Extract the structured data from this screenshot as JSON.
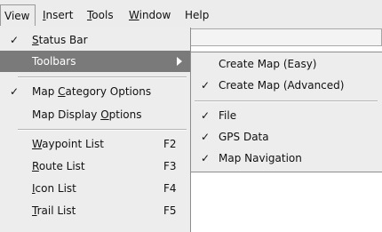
{
  "menubar": {
    "items": [
      {
        "prefix": "",
        "u": "",
        "rest": "View"
      },
      {
        "prefix": "",
        "u": "I",
        "rest": "nsert"
      },
      {
        "prefix": "",
        "u": "T",
        "rest": "ools"
      },
      {
        "prefix": "",
        "u": "W",
        "rest": "indow"
      },
      {
        "prefix": "",
        "u": "",
        "rest": "Help"
      }
    ]
  },
  "view_menu": {
    "items": [
      {
        "check": "✓",
        "prefix": "",
        "u": "S",
        "rest": "tatus Bar",
        "shortcut": ""
      },
      {
        "check": "",
        "prefix": "",
        "u": "",
        "rest": "Toolbars",
        "shortcut": ""
      },
      {
        "check": "✓",
        "prefix": "Map ",
        "u": "C",
        "rest": "ategory Options",
        "shortcut": ""
      },
      {
        "check": "",
        "prefix": "Map Display ",
        "u": "O",
        "rest": "ptions",
        "shortcut": ""
      },
      {
        "check": "",
        "prefix": "",
        "u": "W",
        "rest": "aypoint List",
        "shortcut": "F2"
      },
      {
        "check": "",
        "prefix": "",
        "u": "R",
        "rest": "oute List",
        "shortcut": "F3"
      },
      {
        "check": "",
        "prefix": "",
        "u": "I",
        "rest": "con List",
        "shortcut": "F4"
      },
      {
        "check": "",
        "prefix": "",
        "u": "T",
        "rest": "rail List",
        "shortcut": "F5"
      }
    ]
  },
  "toolbars_submenu": {
    "items": [
      {
        "check": "",
        "label": "Create Map (Easy)"
      },
      {
        "check": "✓",
        "label": "Create Map (Advanced)"
      },
      {
        "check": "✓",
        "label": "File"
      },
      {
        "check": "✓",
        "label": "GPS Data"
      },
      {
        "check": "✓",
        "label": "Map Navigation"
      }
    ]
  },
  "icons": {
    "check": "checkmark-icon",
    "submenu_arrow": "triangle-right-icon"
  },
  "colors": {
    "menu_bg": "#ededed",
    "selected_bg": "#7a7a7a",
    "selected_text": "#ffffff"
  }
}
